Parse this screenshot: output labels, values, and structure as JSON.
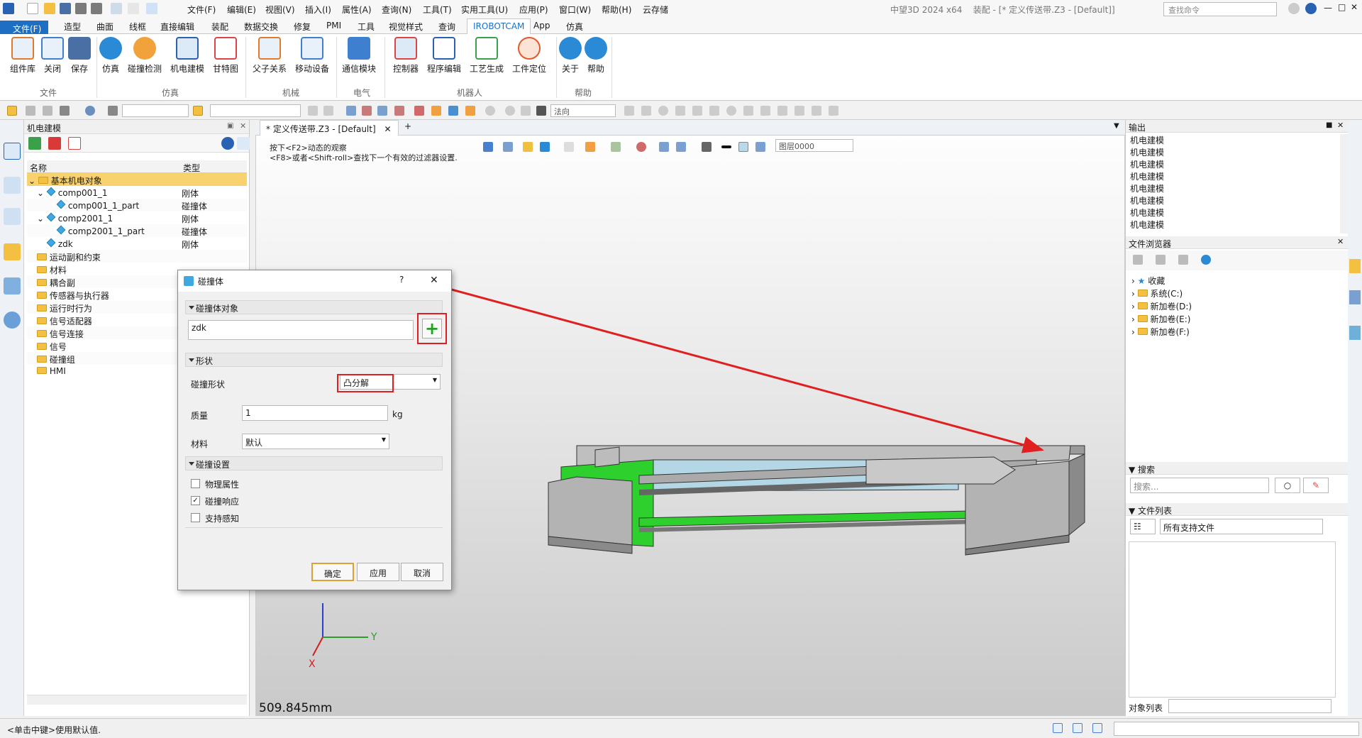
{
  "app": {
    "window_title": "中望3D 2024 x64",
    "doc_title": "装配 - [* 定义传送带.Z3 - [Default]]",
    "cmd_search_placeholder": "查找命令"
  },
  "quick_menu": [
    "文件(F)",
    "编辑(E)",
    "视图(V)",
    "插入(I)",
    "属性(A)",
    "查询(N)",
    "工具(T)",
    "实用工具(U)",
    "应用(P)",
    "窗口(W)",
    "帮助(H)",
    "云存储"
  ],
  "ribbon_tabs": [
    "文件(F)",
    "造型",
    "曲面",
    "线框",
    "直接编辑",
    "装配",
    "数据交换",
    "修复",
    "PMI",
    "工具",
    "视觉样式",
    "查询",
    "IROBOTCAM",
    "App",
    "仿真"
  ],
  "ribbon": {
    "buttons": [
      "组件库",
      "关闭",
      "保存",
      "仿真",
      "碰撞检测",
      "机电建模",
      "甘特图",
      "父子关系",
      "移动设备",
      "通信模块",
      "控制器",
      "程序编辑",
      "工艺生成",
      "工件定位",
      "关于",
      "帮助"
    ],
    "groups": [
      "文件",
      "仿真",
      "机械",
      "电气",
      "机器人",
      "帮助"
    ]
  },
  "toolbar2": {
    "filter_value": "法向"
  },
  "left_panel": {
    "title": "机电建模",
    "col_name": "名称",
    "col_type": "类型",
    "rows": [
      [
        "基本机电对象",
        ""
      ],
      [
        "comp001_1",
        "刚体"
      ],
      [
        "comp001_1_part",
        "碰撞体"
      ],
      [
        "comp2001_1",
        "刚体"
      ],
      [
        "comp2001_1_part",
        "碰撞体"
      ],
      [
        "zdk",
        "刚体"
      ],
      [
        "运动副和约束",
        ""
      ],
      [
        "材料",
        ""
      ],
      [
        "耦合副",
        ""
      ],
      [
        "传感器与执行器",
        ""
      ],
      [
        "运行时行为",
        ""
      ],
      [
        "信号适配器",
        ""
      ],
      [
        "信号连接",
        ""
      ],
      [
        "信号",
        ""
      ],
      [
        "碰撞组",
        ""
      ],
      [
        "HMI",
        ""
      ]
    ]
  },
  "doc_tab": "* 定义传送带.Z3 - [Default]",
  "hints": {
    "line1": "按下<F2>动态的观察",
    "line2": "<F8>或者<Shift-roll>查找下一个有效的过滤器设置."
  },
  "layer": "图层0000",
  "measure": "509.845mm",
  "axes": {
    "x": "X",
    "y": "Y"
  },
  "dialog": {
    "title": "碰撞体",
    "help": "?",
    "close": "✕",
    "sec_objects": "碰撞体对象",
    "object_value": "zdk",
    "sec_shape": "形状",
    "shape_label": "碰撞形状",
    "shape_value": "凸分解",
    "mass_label": "质量",
    "mass_value": "1",
    "mass_unit": "kg",
    "material_label": "材料",
    "material_value": "默认",
    "sec_settings": "碰撞设置",
    "checks": [
      {
        "label": "物理属性",
        "checked": false
      },
      {
        "label": "碰撞响应",
        "checked": true
      },
      {
        "label": "支持感知",
        "checked": false
      }
    ],
    "ok": "确定",
    "apply": "应用",
    "cancel": "取消"
  },
  "output": {
    "title": "输出",
    "lines": [
      "机电建模",
      "机电建模",
      "机电建模",
      "机电建模",
      "机电建模",
      "机电建模",
      "机电建模",
      "机电建模"
    ]
  },
  "browser": {
    "title": "文件浏览器",
    "items": [
      "收藏",
      "系统(C:)",
      "新加卷(D:)",
      "新加卷(E:)",
      "新加卷(F:)"
    ]
  },
  "search": {
    "title": "搜索",
    "placeholder": "搜索..."
  },
  "filelist": {
    "title": "文件列表",
    "filter": "所有支持文件",
    "objlist_label": "对象列表"
  },
  "status": "<单击中键>使用默认值."
}
